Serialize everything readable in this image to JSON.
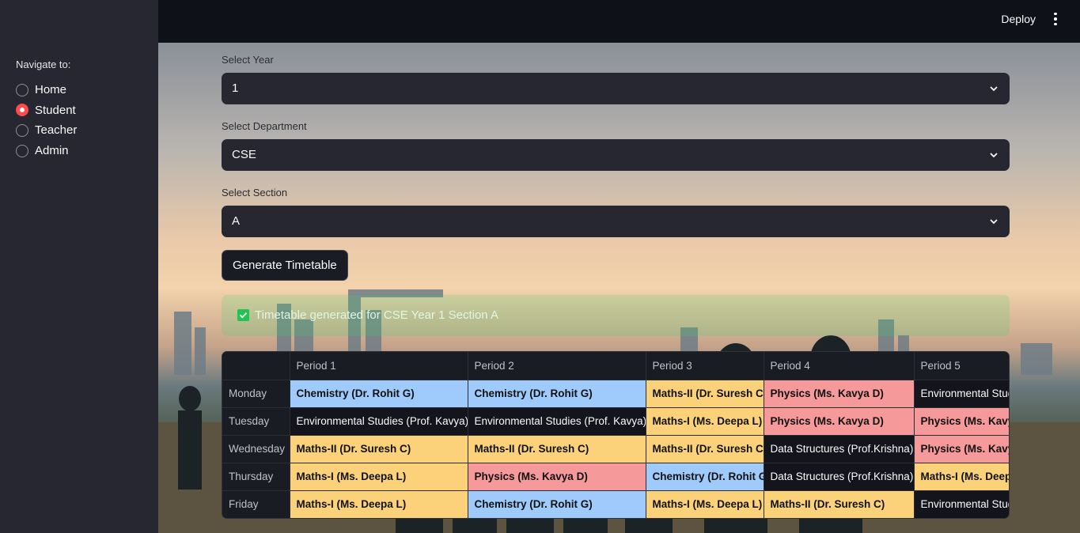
{
  "sidebar": {
    "nav_label": "Navigate to:",
    "items": [
      {
        "label": "Home",
        "selected": false
      },
      {
        "label": "Student",
        "selected": true
      },
      {
        "label": "Teacher",
        "selected": false
      },
      {
        "label": "Admin",
        "selected": false
      }
    ]
  },
  "header": {
    "deploy_label": "Deploy",
    "menu_icon": "kebab-menu-icon"
  },
  "form": {
    "year": {
      "label": "Select Year",
      "value": "1"
    },
    "department": {
      "label": "Select Department",
      "value": "CSE"
    },
    "section": {
      "label": "Select Section",
      "value": "A"
    },
    "generate_label": "Generate Timetable"
  },
  "success_message": "Timetable generated for CSE Year 1 Section A",
  "timetable": {
    "headers": [
      "",
      "Period 1",
      "Period 2",
      "Period 3",
      "Period 4",
      "Period 5"
    ],
    "rows": [
      {
        "day": "Monday",
        "cells": [
          {
            "text": "Chemistry (Dr. Rohit G)",
            "color": "blue"
          },
          {
            "text": "Chemistry (Dr. Rohit G)",
            "color": "blue"
          },
          {
            "text": "Maths-II (Dr. Suresh C)",
            "color": "yellow"
          },
          {
            "text": "Physics (Ms. Kavya D)",
            "color": "red"
          },
          {
            "text": "Environmental Studies (Prof. Kavya)",
            "color": "dark"
          }
        ]
      },
      {
        "day": "Tuesday",
        "cells": [
          {
            "text": "Environmental Studies (Prof. Kavya)",
            "color": "dark"
          },
          {
            "text": "Environmental Studies (Prof. Kavya)",
            "color": "dark"
          },
          {
            "text": "Maths-I (Ms. Deepa L)",
            "color": "yellow"
          },
          {
            "text": "Physics (Ms. Kavya D)",
            "color": "red"
          },
          {
            "text": "Physics (Ms. Kavya D)",
            "color": "red"
          }
        ]
      },
      {
        "day": "Wednesday",
        "cells": [
          {
            "text": "Maths-II (Dr. Suresh C)",
            "color": "yellow"
          },
          {
            "text": "Maths-II (Dr. Suresh C)",
            "color": "yellow"
          },
          {
            "text": "Maths-II (Dr. Suresh C)",
            "color": "yellow"
          },
          {
            "text": "Data Structures (Prof.Krishna)",
            "color": "dark"
          },
          {
            "text": "Physics (Ms. Kavya D)",
            "color": "red"
          }
        ]
      },
      {
        "day": "Thursday",
        "cells": [
          {
            "text": "Maths-I (Ms. Deepa L)",
            "color": "yellow"
          },
          {
            "text": "Physics (Ms. Kavya D)",
            "color": "red"
          },
          {
            "text": "Chemistry (Dr. Rohit G)",
            "color": "blue"
          },
          {
            "text": "Data Structures (Prof.Krishna)",
            "color": "dark"
          },
          {
            "text": "Maths-I (Ms. Deepa L)",
            "color": "yellow"
          }
        ]
      },
      {
        "day": "Friday",
        "cells": [
          {
            "text": "Maths-I (Ms. Deepa L)",
            "color": "yellow"
          },
          {
            "text": "Chemistry (Dr. Rohit G)",
            "color": "blue"
          },
          {
            "text": "Maths-I (Ms. Deepa L)",
            "color": "yellow"
          },
          {
            "text": "Maths-II (Dr. Suresh C)",
            "color": "yellow"
          },
          {
            "text": "Environmental Studies (Prof. Kavya)",
            "color": "dark"
          }
        ]
      }
    ]
  },
  "colors": {
    "sidebar_bg": "#262730",
    "app_bg": "#0e1117",
    "accent": "#ff4b4b",
    "success": "#21c354",
    "subject_blue": "#9ecbfb",
    "subject_yellow": "#fbd27a",
    "subject_red": "#f6999b",
    "subject_dark": "#14151c"
  }
}
